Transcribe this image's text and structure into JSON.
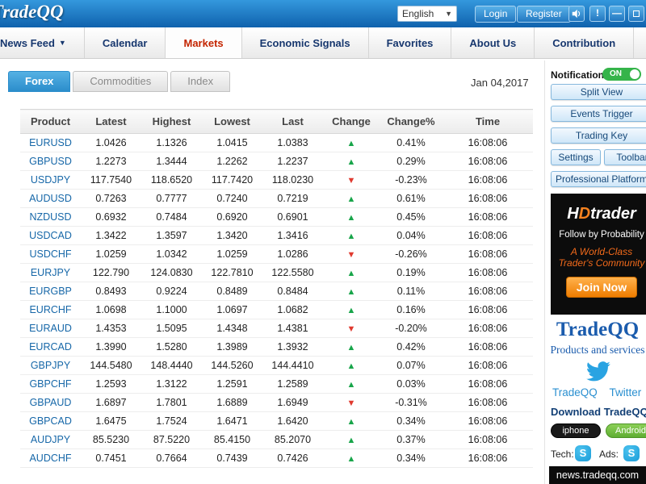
{
  "topbar": {
    "logo": "TradeQQ",
    "language_select": "English",
    "login_label": "Login",
    "register_label": "Register"
  },
  "nav": {
    "items": [
      {
        "label": "News Feed"
      },
      {
        "label": "Calendar"
      },
      {
        "label": "Markets"
      },
      {
        "label": "Economic Signals"
      },
      {
        "label": "Favorites"
      },
      {
        "label": "About Us"
      },
      {
        "label": "Contribution"
      }
    ],
    "active": "Markets"
  },
  "tabs": {
    "forex": "Forex",
    "commodities": "Commodities",
    "index": "Index",
    "date": "Jan 04,2017"
  },
  "table": {
    "headers": [
      "Product",
      "Latest",
      "Highest",
      "Lowest",
      "Last",
      "Change",
      "Change%",
      "Time"
    ],
    "rows": [
      {
        "product": "EURUSD",
        "latest": "1.0426",
        "highest": "1.1326",
        "lowest": "1.0415",
        "last": "1.0383",
        "direction": "up",
        "change_pct": "0.41%",
        "time": "16:08:06"
      },
      {
        "product": "GBPUSD",
        "latest": "1.2273",
        "highest": "1.3444",
        "lowest": "1.2262",
        "last": "1.2237",
        "direction": "up",
        "change_pct": "0.29%",
        "time": "16:08:06"
      },
      {
        "product": "USDJPY",
        "latest": "117.7540",
        "highest": "118.6520",
        "lowest": "117.7420",
        "last": "118.0230",
        "direction": "down",
        "change_pct": "-0.23%",
        "time": "16:08:06"
      },
      {
        "product": "AUDUSD",
        "latest": "0.7263",
        "highest": "0.7777",
        "lowest": "0.7240",
        "last": "0.7219",
        "direction": "up",
        "change_pct": "0.61%",
        "time": "16:08:06"
      },
      {
        "product": "NZDUSD",
        "latest": "0.6932",
        "highest": "0.7484",
        "lowest": "0.6920",
        "last": "0.6901",
        "direction": "up",
        "change_pct": "0.45%",
        "time": "16:08:06"
      },
      {
        "product": "USDCAD",
        "latest": "1.3422",
        "highest": "1.3597",
        "lowest": "1.3420",
        "last": "1.3416",
        "direction": "up",
        "change_pct": "0.04%",
        "time": "16:08:06"
      },
      {
        "product": "USDCHF",
        "latest": "1.0259",
        "highest": "1.0342",
        "lowest": "1.0259",
        "last": "1.0286",
        "direction": "down",
        "change_pct": "-0.26%",
        "time": "16:08:06"
      },
      {
        "product": "EURJPY",
        "latest": "122.790",
        "highest": "124.0830",
        "lowest": "122.7810",
        "last": "122.5580",
        "direction": "up",
        "change_pct": "0.19%",
        "time": "16:08:06"
      },
      {
        "product": "EURGBP",
        "latest": "0.8493",
        "highest": "0.9224",
        "lowest": "0.8489",
        "last": "0.8484",
        "direction": "up",
        "change_pct": "0.11%",
        "time": "16:08:06"
      },
      {
        "product": "EURCHF",
        "latest": "1.0698",
        "highest": "1.1000",
        "lowest": "1.0697",
        "last": "1.0682",
        "direction": "up",
        "change_pct": "0.16%",
        "time": "16:08:06"
      },
      {
        "product": "EURAUD",
        "latest": "1.4353",
        "highest": "1.5095",
        "lowest": "1.4348",
        "last": "1.4381",
        "direction": "down",
        "change_pct": "-0.20%",
        "time": "16:08:06"
      },
      {
        "product": "EURCAD",
        "latest": "1.3990",
        "highest": "1.5280",
        "lowest": "1.3989",
        "last": "1.3932",
        "direction": "up",
        "change_pct": "0.42%",
        "time": "16:08:06"
      },
      {
        "product": "GBPJPY",
        "latest": "144.5480",
        "highest": "148.4440",
        "lowest": "144.5260",
        "last": "144.4410",
        "direction": "up",
        "change_pct": "0.07%",
        "time": "16:08:06"
      },
      {
        "product": "GBPCHF",
        "latest": "1.2593",
        "highest": "1.3122",
        "lowest": "1.2591",
        "last": "1.2589",
        "direction": "up",
        "change_pct": "0.03%",
        "time": "16:08:06"
      },
      {
        "product": "GBPAUD",
        "latest": "1.6897",
        "highest": "1.7801",
        "lowest": "1.6889",
        "last": "1.6949",
        "direction": "down",
        "change_pct": "-0.31%",
        "time": "16:08:06"
      },
      {
        "product": "GBPCAD",
        "latest": "1.6475",
        "highest": "1.7524",
        "lowest": "1.6471",
        "last": "1.6420",
        "direction": "up",
        "change_pct": "0.34%",
        "time": "16:08:06"
      },
      {
        "product": "AUDJPY",
        "latest": "85.5230",
        "highest": "87.5220",
        "lowest": "85.4150",
        "last": "85.2070",
        "direction": "up",
        "change_pct": "0.37%",
        "time": "16:08:06"
      },
      {
        "product": "AUDCHF",
        "latest": "0.7451",
        "highest": "0.7664",
        "lowest": "0.7439",
        "last": "0.7426",
        "direction": "up",
        "change_pct": "0.34%",
        "time": "16:08:06"
      }
    ]
  },
  "sidebar": {
    "notifications_label": "Notifications",
    "notifications_toggle": "ON",
    "buttons": [
      "Split View",
      "Events Trigger",
      "Trading Key",
      "Settings",
      "Toolbar",
      "Professional Platform"
    ],
    "ad": {
      "brand_h": "H",
      "brand_d": "D",
      "brand_rest": "trader",
      "line1": "Follow by Probability",
      "line2": "A World-Class",
      "line3": "Trader's Community",
      "cta": "Join Now"
    },
    "promo": {
      "title": "TradeQQ",
      "subtitle": "Products and services",
      "twitter_line": "TradeQQ    Twitter"
    },
    "download": {
      "heading": "Download TradeQQ App",
      "iphone": "iphone",
      "android": "Android"
    },
    "contact": {
      "tech_label": "Tech:",
      "ads_label": "Ads:",
      "skype_glyph": "S"
    },
    "footer": "news.tradeqq.com"
  },
  "glyphs": {
    "up_arrow": "▲",
    "down_arrow": "▼",
    "dropdown": "▼",
    "alert": "!",
    "minimize": "—"
  },
  "colors": {
    "up_green": "#18a54a",
    "down_red": "#e03a2f",
    "accent_blue": "#2b8dcb",
    "link_blue": "#1667a8",
    "markets_red": "#c42500",
    "toggle_green": "#35b44a",
    "android_green": "#6cbf47",
    "ad_orange": "#f58220"
  }
}
